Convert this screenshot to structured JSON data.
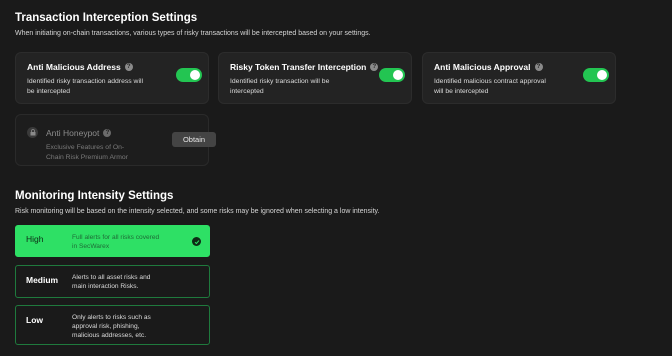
{
  "interception": {
    "title": "Transaction Interception Settings",
    "description": "When initiating on-chain transactions, various types of risky transactions will be intercepted based on your settings.",
    "cards": [
      {
        "title": "Anti Malicious Address",
        "desc_line1": "Identified risky transaction address will",
        "desc_line2": "be intercepted",
        "enabled": true
      },
      {
        "title": "Risky Token Transfer Interception",
        "desc_line1": "Identified risky transaction will be",
        "desc_line2": "intercepted",
        "enabled": true
      },
      {
        "title": "Anti Malicious Approval",
        "desc_line1": "Identified malicious contract approval",
        "desc_line2": "will be intercepted",
        "enabled": true
      }
    ],
    "honeypot": {
      "title": "Anti Honeypot",
      "desc_line1": "Exclusive Features of On-",
      "desc_line2": "Chain Risk Premium Armor",
      "button_label": "Obtain"
    }
  },
  "monitoring": {
    "title": "Monitoring Intensity Settings",
    "description": "Risk monitoring will be based on the intensity selected, and some risks may be ignored when selecting a low intensity.",
    "levels": [
      {
        "name": "High",
        "desc_line1": "Full alerts for all risks covered",
        "desc_line2": "in SecWarex",
        "desc_line3": "",
        "selected": true
      },
      {
        "name": "Medium",
        "desc_line1": "Alerts to all asset risks and",
        "desc_line2": "main interaction Risks.",
        "desc_line3": "",
        "selected": false
      },
      {
        "name": "Low",
        "desc_line1": "Only alerts to risks such as",
        "desc_line2": "approval risk, phishing,",
        "desc_line3": "malicious addresses, etc.",
        "selected": false
      }
    ]
  },
  "colors": {
    "accent": "#2ee065",
    "toggle_on": "#23c552",
    "background": "#1a1a1a",
    "card": "#232323"
  },
  "icons": {
    "help": "question-circle-icon",
    "toggle": "toggle-switch",
    "lock": "lock-icon",
    "check": "check-circle-icon"
  }
}
